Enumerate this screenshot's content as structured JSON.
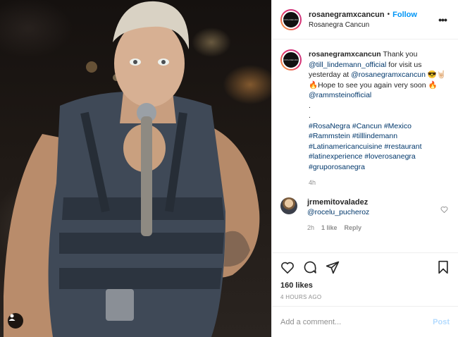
{
  "header": {
    "username": "rosanegramxcancun",
    "separator": "•",
    "follow_label": "Follow",
    "location": "Rosanegra Cancun",
    "avatar_text": "ROSANEGRA"
  },
  "caption": {
    "username": "rosanegramxcancun",
    "text1": " Thank you ",
    "mention1": "@till_lindemann_official",
    "text2": " for visit us yesterday at ",
    "mention2": "@rosanegramxcancun",
    "text3": " 😎🤘🏻🔥Hope to see you again very soon 🔥",
    "mention3": "@rammsteinofficial",
    "dots": [
      ".",
      "."
    ],
    "hashtags": [
      "#RosaNegra",
      "#Cancun",
      "#Mexico",
      "#Rammstein",
      "#tilllindemann",
      "#Latinamericancuisine",
      "#restaurant",
      "#latinexperience",
      "#loverosanegra",
      "#gruporosanegra"
    ],
    "time": "4h"
  },
  "comment": {
    "username": "jrmemitovaladez",
    "mention": "@rocelu_pucheroz",
    "time": "2h",
    "likes": "1 like",
    "reply": "Reply"
  },
  "stats": {
    "likes": "160 likes",
    "ago": "4 HOURS AGO"
  },
  "add_comment": {
    "placeholder": "Add a comment...",
    "post_label": "Post"
  },
  "icons": [
    "heart-icon",
    "comment-icon",
    "share-icon",
    "bookmark-icon",
    "more-icon",
    "user-tag-icon",
    "like-small-icon"
  ],
  "colors": {
    "accent": "#0095f6",
    "post_disabled": "#b3dbff",
    "mention": "#00376b"
  }
}
